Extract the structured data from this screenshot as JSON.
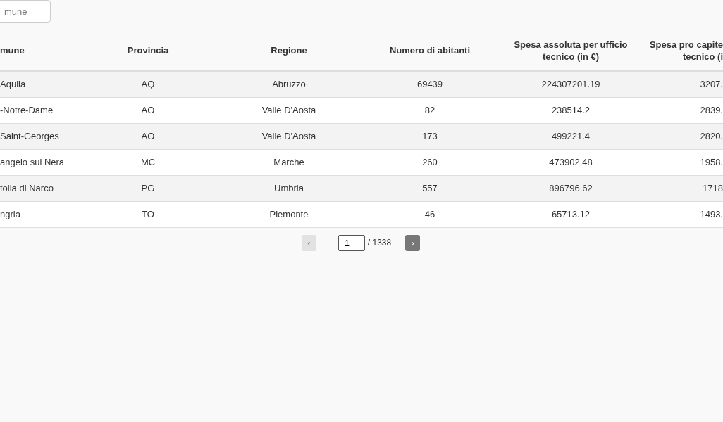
{
  "search": {
    "placeholder": "mune"
  },
  "table": {
    "columns": [
      "mune",
      "Provincia",
      "Regione",
      "Numero di abitanti",
      "Spesa assoluta per ufficio tecnico (in €)",
      "Spesa pro capite tecnico (i"
    ],
    "rows": [
      [
        "Aquila",
        "AQ",
        "Abruzzo",
        "69439",
        "224307201.19",
        "3207."
      ],
      [
        "-Notre-Dame",
        "AO",
        "Valle D'Aosta",
        "82",
        "238514.2",
        "2839."
      ],
      [
        "Saint-Georges",
        "AO",
        "Valle D'Aosta",
        "173",
        "499221.4",
        "2820."
      ],
      [
        "angelo sul Nera",
        "MC",
        "Marche",
        "260",
        "473902.48",
        "1958."
      ],
      [
        "tolia di Narco",
        "PG",
        "Umbria",
        "557",
        "896796.62",
        "1718"
      ],
      [
        "ngria",
        "TO",
        "Piemonte",
        "46",
        "65713.12",
        "1493."
      ]
    ]
  },
  "pagination": {
    "prev": {
      "label": "‹",
      "disabled": true
    },
    "page": "1",
    "total": "/ 1338",
    "next": {
      "label": "›",
      "disabled": false
    }
  }
}
